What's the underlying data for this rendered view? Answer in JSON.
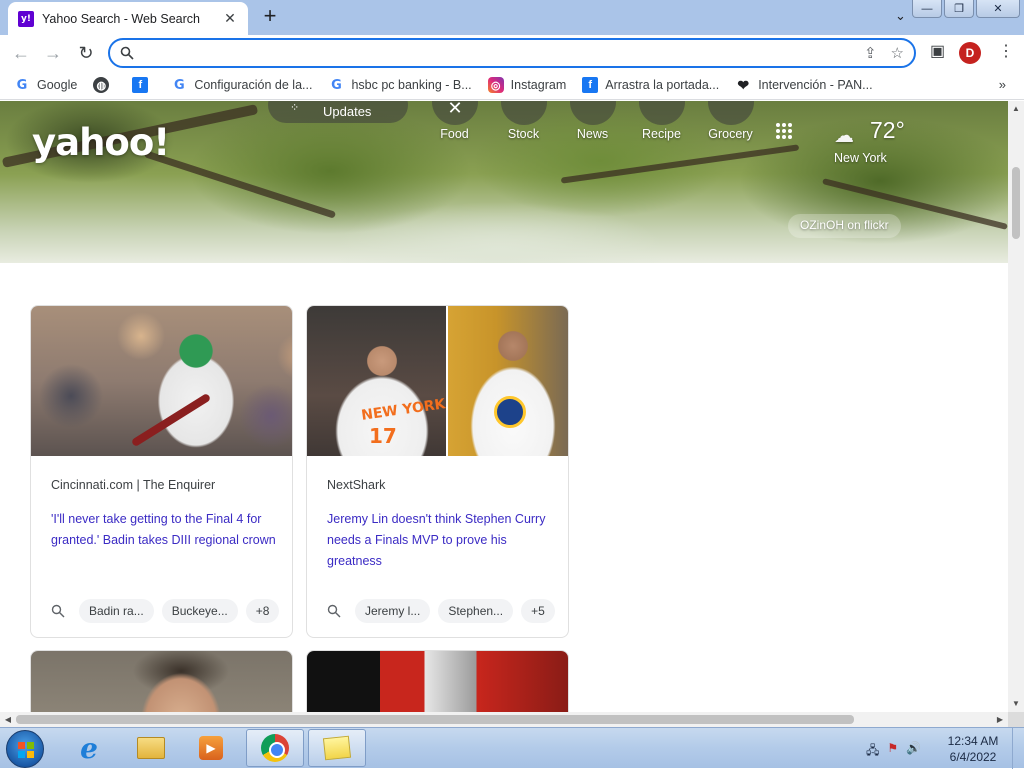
{
  "browser": {
    "tab_title": "Yahoo Search - Web Search",
    "tab_favicon": "y!",
    "address_value": "",
    "profile_initial": "D"
  },
  "bookmarks": [
    {
      "label": "Google",
      "icon": "google-icon"
    },
    {
      "label": "",
      "icon": "globe-icon"
    },
    {
      "label": "",
      "icon": "facebook-icon"
    },
    {
      "label": "Configuración de la...",
      "icon": "google-icon"
    },
    {
      "label": "hsbc pc banking - B...",
      "icon": "google-icon"
    },
    {
      "label": "Instagram",
      "icon": "instagram-icon"
    },
    {
      "label": "Arrastra la portada...",
      "icon": "facebook-icon"
    },
    {
      "label": "Intervención - PAN...",
      "icon": "heart-icon"
    }
  ],
  "yahoo": {
    "logo": "yahoo!",
    "updates_label": "Updates",
    "quick_links": [
      "Food",
      "Stock",
      "News",
      "Recipe",
      "Grocery"
    ],
    "weather": {
      "temp": "72°",
      "city": "New York"
    },
    "photo_credit": "OZinOH on flickr"
  },
  "cards": [
    {
      "source": "Cincinnati.com | The Enquirer",
      "title": "'I'll never take getting to the Final 4 for granted.' Badin takes DIII regional crown",
      "tags": [
        "Badin ra...",
        "Buckeye...",
        "+8"
      ]
    },
    {
      "source": "NextShark",
      "title": "Jeremy Lin doesn't think Stephen Curry needs a Finals MVP to prove his greatness",
      "tags": [
        "Jeremy l...",
        "Stephen...",
        "+5"
      ]
    }
  ],
  "nba_image": {
    "jersey": "NEW YORK",
    "number": "17"
  },
  "taskbar": {
    "time": "12:34 AM",
    "date": "6/4/2022"
  },
  "colors": {
    "accent": "#1a73e8",
    "headline_link": "#3b2bc4",
    "yahoo_purple": "#6001d2"
  }
}
